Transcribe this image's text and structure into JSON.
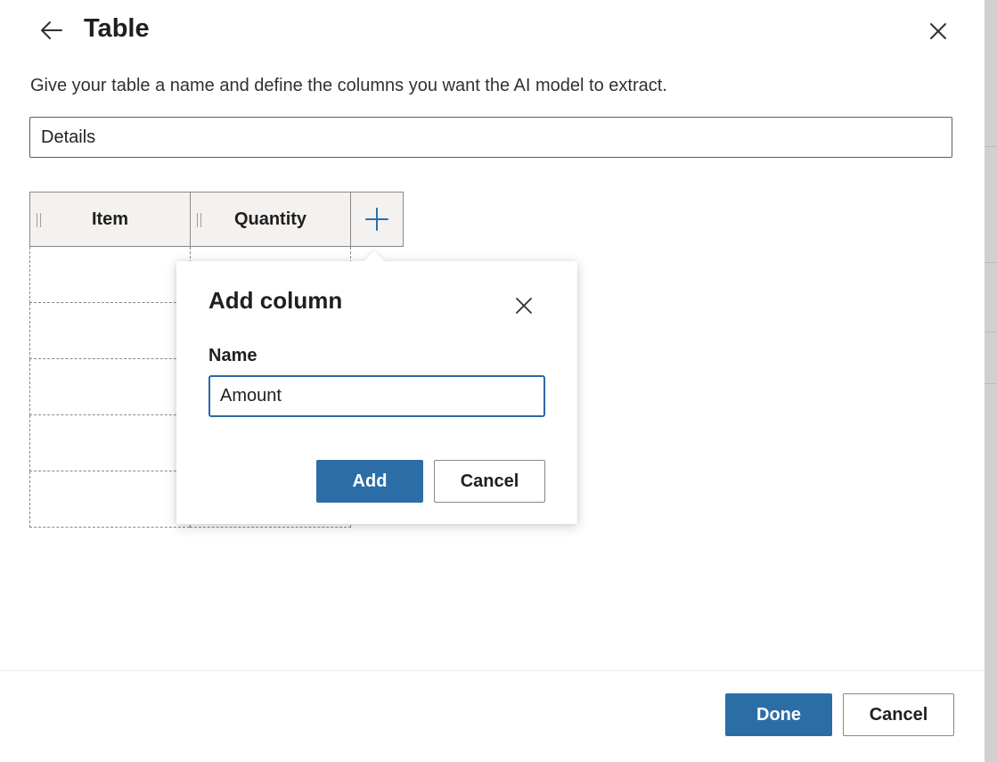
{
  "header": {
    "title": "Table"
  },
  "description": "Give your table a name and define the columns you want the AI model to extract.",
  "table_name": {
    "value": "Details"
  },
  "table": {
    "columns": [
      {
        "label": "Item"
      },
      {
        "label": "Quantity"
      }
    ]
  },
  "popup": {
    "title": "Add column",
    "name_label": "Name",
    "name_value": "Amount",
    "add_label": "Add",
    "cancel_label": "Cancel"
  },
  "footer": {
    "done_label": "Done",
    "cancel_label": "Cancel"
  },
  "colors": {
    "primary": "#2b6ea7",
    "focus_border": "#2b6aa3",
    "header_bg": "#f3f2f1"
  }
}
